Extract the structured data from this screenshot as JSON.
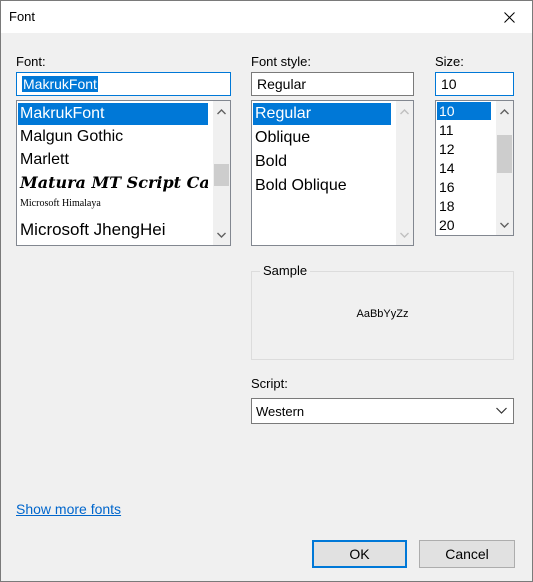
{
  "window": {
    "title": "Font"
  },
  "font": {
    "label": "Font:",
    "value": "MakrukFont",
    "list": [
      {
        "name": "MakrukFont",
        "selected": true
      },
      {
        "name": "Malgun Gothic",
        "selected": false
      },
      {
        "name": "Marlett",
        "selected": false
      },
      {
        "name": "Matura MT Script Capitals",
        "selected": false
      },
      {
        "name": "Microsoft Himalaya",
        "selected": false
      },
      {
        "name": "Microsoft JhengHei",
        "selected": false
      }
    ]
  },
  "style": {
    "label": "Font style:",
    "value": "Regular",
    "list": [
      {
        "name": "Regular",
        "selected": true
      },
      {
        "name": "Oblique",
        "selected": false
      },
      {
        "name": "Bold",
        "selected": false
      },
      {
        "name": "Bold Oblique",
        "selected": false
      }
    ]
  },
  "size": {
    "label": "Size:",
    "value": "10",
    "list": [
      {
        "name": "10",
        "selected": true
      },
      {
        "name": "11",
        "selected": false
      },
      {
        "name": "12",
        "selected": false
      },
      {
        "name": "14",
        "selected": false
      },
      {
        "name": "16",
        "selected": false
      },
      {
        "name": "18",
        "selected": false
      },
      {
        "name": "20",
        "selected": false
      }
    ]
  },
  "sample": {
    "label": "Sample",
    "text": "AaBbYyZz"
  },
  "script": {
    "label": "Script:",
    "value": "Western"
  },
  "links": {
    "more_fonts": "Show more fonts"
  },
  "buttons": {
    "ok": "OK",
    "cancel": "Cancel"
  },
  "icons": {
    "close": "close-icon",
    "scroll_up": "chevron-up-icon",
    "scroll_down": "chevron-down-icon",
    "combo": "chevron-down-icon"
  },
  "colors": {
    "accent": "#0078d7",
    "link": "#0066cc",
    "dialog_bg": "#f0f0f0"
  }
}
